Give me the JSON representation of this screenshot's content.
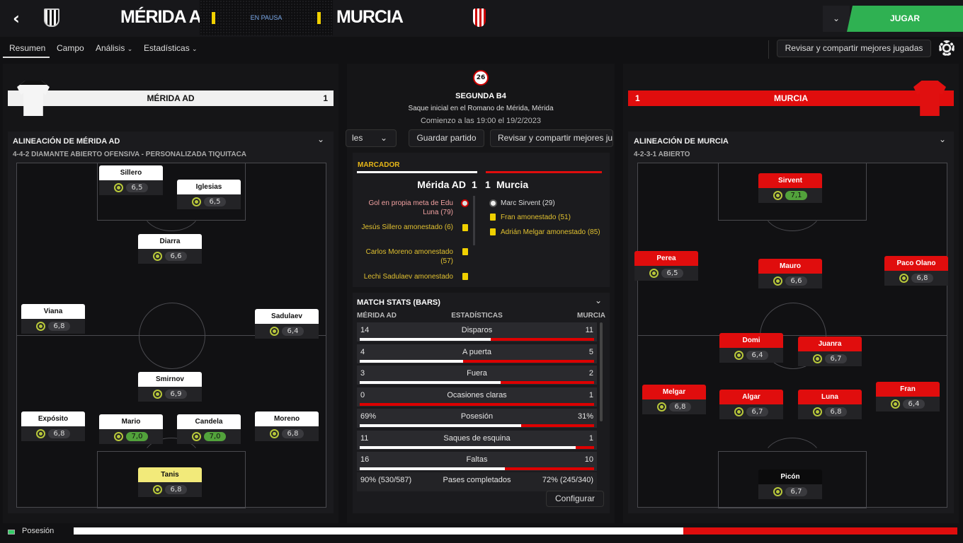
{
  "header": {
    "home_name": "MÉRIDA AD",
    "away_name": "MURCIA",
    "status": "EN PAUSA",
    "play_label": "JUGAR"
  },
  "tabs": {
    "summary": "Resumen",
    "field": "Campo",
    "analysis": "Análisis",
    "stats": "Estadísticas"
  },
  "review_button": "Revisar y compartir mejores jugadas",
  "home": {
    "name": "MÉRIDA AD",
    "score": "1",
    "lineup_title": "ALINEACIÓN DE MÉRIDA AD",
    "formation": "4-4-2 DIAMANTE ABIERTO OFENSIVA - PERSONALIZADA TIQUITACA",
    "players": [
      {
        "name": "Sillero",
        "rating": "6,5"
      },
      {
        "name": "Iglesias",
        "rating": "6,5"
      },
      {
        "name": "Diarra",
        "rating": "6,6"
      },
      {
        "name": "Viana",
        "rating": "6,8"
      },
      {
        "name": "Sadulaev",
        "rating": "6,4"
      },
      {
        "name": "Smirnov",
        "rating": "6,9"
      },
      {
        "name": "Expósito",
        "rating": "6,8"
      },
      {
        "name": "Mario",
        "rating": "7,0"
      },
      {
        "name": "Candela",
        "rating": "7,0"
      },
      {
        "name": "Moreno",
        "rating": "6,8"
      },
      {
        "name": "Tanis",
        "rating": "6,8"
      }
    ]
  },
  "away": {
    "name": "MURCIA",
    "score": "1",
    "lineup_title": "ALINEACIÓN DE MURCIA",
    "formation": "4-2-3-1 ABIERTO",
    "players": [
      {
        "name": "Sirvent",
        "rating": "7,1"
      },
      {
        "name": "Perea",
        "rating": "6,5"
      },
      {
        "name": "Mauro",
        "rating": "6,6"
      },
      {
        "name": "Paco Olano",
        "rating": "6,8"
      },
      {
        "name": "Domi",
        "rating": "6,4"
      },
      {
        "name": "Juanra",
        "rating": "6,7"
      },
      {
        "name": "Melgar",
        "rating": "6,8"
      },
      {
        "name": "Algar",
        "rating": "6,7"
      },
      {
        "name": "Luna",
        "rating": "6,8"
      },
      {
        "name": "Fran",
        "rating": "6,4"
      },
      {
        "name": "Picón",
        "rating": "6,7"
      }
    ]
  },
  "match": {
    "competition_badge": "26",
    "competition": "SEGUNDA B4",
    "venue": "Saque inicial en el Romano de Mérida, Mérida",
    "kickoff": "Comienzo a las 19:00 el 19/2/2023"
  },
  "center_toolbar": {
    "selector": "les",
    "save": "Guardar partido",
    "review": "Revisar y compartir mejores ju"
  },
  "scoreboard": {
    "title": "MARCADOR",
    "home": "Mérida AD",
    "home_score": "1",
    "away_score": "1",
    "away": "Murcia",
    "home_events": [
      "Gol en propia meta de Edu Luna (79)",
      "Jesús Sillero amonestado (6)",
      "Carlos Moreno amonestado (57)",
      "Lechi Sadulaev amonestado"
    ],
    "away_events": [
      "Marc Sirvent (29)",
      "Fran amonestado (51)",
      "Adrián Melgar amonestado (85)"
    ]
  },
  "stats": {
    "title": "MATCH STATS (BARS)",
    "home_head": "MÉRIDA AD",
    "mid_head": "ESTADÍSTICAS",
    "away_head": "MURCIA",
    "rows": [
      {
        "label": "Disparos",
        "home": "14",
        "away": "11",
        "home_frac": 0.56
      },
      {
        "label": "A puerta",
        "home": "4",
        "away": "5",
        "home_frac": 0.44
      },
      {
        "label": "Fuera",
        "home": "3",
        "away": "2",
        "home_frac": 0.6
      },
      {
        "label": "Ocasiones claras",
        "home": "0",
        "away": "1",
        "home_frac": 0.0
      },
      {
        "label": "Posesión",
        "home": "69%",
        "away": "31%",
        "home_frac": 0.69
      },
      {
        "label": "Saques de esquina",
        "home": "11",
        "away": "1",
        "home_frac": 0.92
      },
      {
        "label": "Faltas",
        "home": "16",
        "away": "10",
        "home_frac": 0.62
      }
    ],
    "passes": {
      "label": "Pases completados",
      "home": "90% (530/587)",
      "away": "72% (245/340)"
    },
    "configure": "Configurar"
  },
  "footer": {
    "label": "Posesión",
    "home_possession": 0.69
  },
  "colors": {
    "home": "#ffffff",
    "away": "#e00d0d",
    "accent": "#2fb152",
    "card": "#f0d000"
  }
}
